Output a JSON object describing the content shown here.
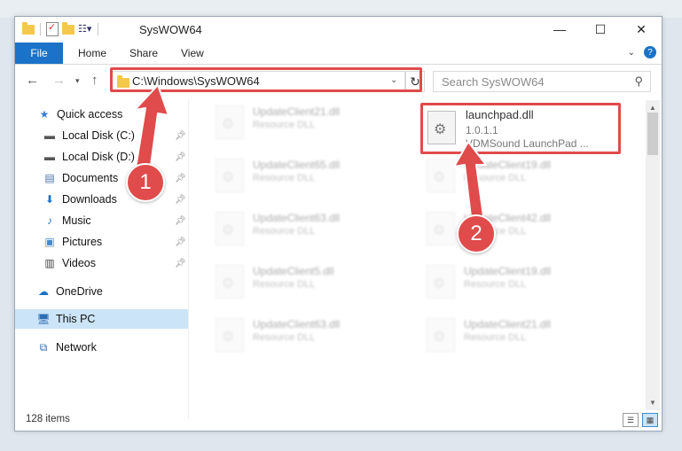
{
  "window": {
    "title": "SysWOW64",
    "ribbon_tabs": [
      "File",
      "Home",
      "Share",
      "View"
    ],
    "minimize": "—",
    "maximize": "☐",
    "close": "✕",
    "help": "?"
  },
  "navigation": {
    "address": "C:\\Windows\\SysWOW64",
    "search_placeholder": "Search SysWOW64"
  },
  "sidebar": {
    "items": [
      {
        "label": "Quick access",
        "icon": "star-icon",
        "pinned": false
      },
      {
        "label": "Local Disk (C:)",
        "icon": "drive-icon",
        "pinned": true
      },
      {
        "label": "Local Disk (D:)",
        "icon": "drive-icon",
        "pinned": true
      },
      {
        "label": "Documents",
        "icon": "documents-icon",
        "pinned": true
      },
      {
        "label": "Downloads",
        "icon": "downloads-icon",
        "pinned": true
      },
      {
        "label": "Music",
        "icon": "music-icon",
        "pinned": true
      },
      {
        "label": "Pictures",
        "icon": "pictures-icon",
        "pinned": true
      },
      {
        "label": "Videos",
        "icon": "videos-icon",
        "pinned": true
      },
      {
        "label": "OneDrive",
        "icon": "cloud-icon",
        "pinned": false
      },
      {
        "label": "This PC",
        "icon": "computer-icon",
        "pinned": false,
        "selected": true
      },
      {
        "label": "Network",
        "icon": "network-icon",
        "pinned": false
      }
    ]
  },
  "files": {
    "left_column": [
      {
        "name": "UpdateClient21.dll",
        "type": "Resource DLL"
      },
      {
        "name": "UpdateClient65.dll",
        "type": "Resource DLL"
      },
      {
        "name": "UpdateClient63.dll",
        "type": "Resource DLL"
      },
      {
        "name": "UpdateClient5.dll",
        "type": "Resource DLL"
      },
      {
        "name": "UpdateClient63.dll",
        "type": "Resource DLL"
      }
    ],
    "right_column": [
      {
        "name": "UpdateClient19.dll",
        "type": "Resource DLL"
      },
      {
        "name": "UpdateClient42.dll",
        "type": "Resource DLL"
      },
      {
        "name": "UpdateClient19.dll",
        "type": "Resource DLL"
      },
      {
        "name": "UpdateClient21.dll",
        "type": "Resource DLL"
      }
    ],
    "target": {
      "name": "launchpad.dll",
      "version": "1.0.1.1",
      "description": "VDMSound LaunchPad ..."
    }
  },
  "status": {
    "item_count": "128 items"
  },
  "annotations": {
    "step1": "1",
    "step2": "2",
    "color": "#e04b4b"
  }
}
